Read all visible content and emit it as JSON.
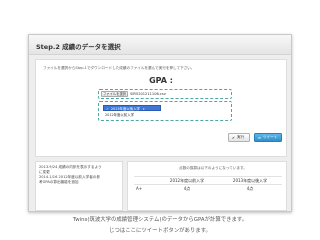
{
  "header": {
    "title": "Step.2 成績のデータを選択"
  },
  "panel": {
    "instruction": "ファイルを選択からStep.1でダウンロードした成績のファイルを選んで実行を押して下さい。",
    "gpa_label": "GPA :",
    "file_button_label": "ファイルを選択",
    "file_name": "SIR5201211106.csv",
    "dropdown": {
      "selected": "2013年度以後入学",
      "options": [
        "2013年度以後入学",
        "2012年度以前入学"
      ]
    },
    "run_button_label": "実行",
    "tweet_button_label": "ツイート"
  },
  "notes": {
    "lines": [
      "2013.9/24 成績の内訳を表示するよう",
      "に変更",
      "2014.1/16 2012年度以前入学者の参",
      "考GPAの算出機能を追加"
    ]
  },
  "score_table": {
    "note": "点数の換算は以下のようになっています。",
    "headers": [
      "",
      "2012年度以前入学",
      "2013年度以後入学"
    ],
    "rows": [
      [
        "A+",
        "4点",
        "4点"
      ]
    ]
  },
  "caption": {
    "line1": "Twins(筑波大学の成績管理システム)のデータからGPAが計算できます。",
    "line2": "じつはここにツイートボタンがあります。"
  },
  "icons": {
    "check": "check-icon",
    "caret": "caret-down-icon",
    "run": "play-icon",
    "tweet": "tweet-arrow-icon"
  },
  "colors": {
    "highlight_border": "#4fa6a6",
    "selected_option": "#3b78d9",
    "tweet_button": "#2f8fcf"
  }
}
